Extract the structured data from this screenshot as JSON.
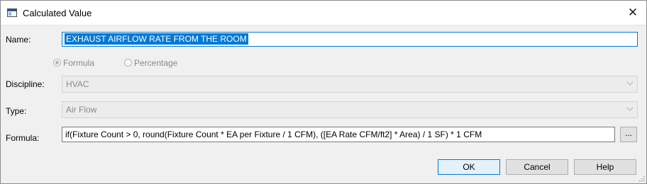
{
  "window": {
    "title": "Calculated Value",
    "close_glyph": "✕"
  },
  "name": {
    "label": "Name:",
    "value": "EXHAUST AIRFLOW RATE FROM THE ROOM"
  },
  "mode": {
    "formula_label": "Formula",
    "percentage_label": "Percentage",
    "selected": "Formula"
  },
  "discipline": {
    "label": "Discipline:",
    "value": "HVAC"
  },
  "type": {
    "label": "Type:",
    "value": "Air Flow"
  },
  "formula": {
    "label": "Formula:",
    "value": "if(Fixture Count > 0, round(Fixture Count * EA per Fixture / 1 CFM), ([EA Rate CFM/ft2] * Area) / 1 SF) * 1 CFM",
    "browse_label": "..."
  },
  "buttons": {
    "ok": "OK",
    "cancel": "Cancel",
    "help": "Help"
  },
  "colors": {
    "accent": "#0078d7",
    "dialog_bg": "#f0f0f0",
    "disabled_text": "#8a8a8a"
  },
  "icons": [
    "window-app-icon",
    "close-icon",
    "chevron-down-icon",
    "resize-grip-icon"
  ]
}
